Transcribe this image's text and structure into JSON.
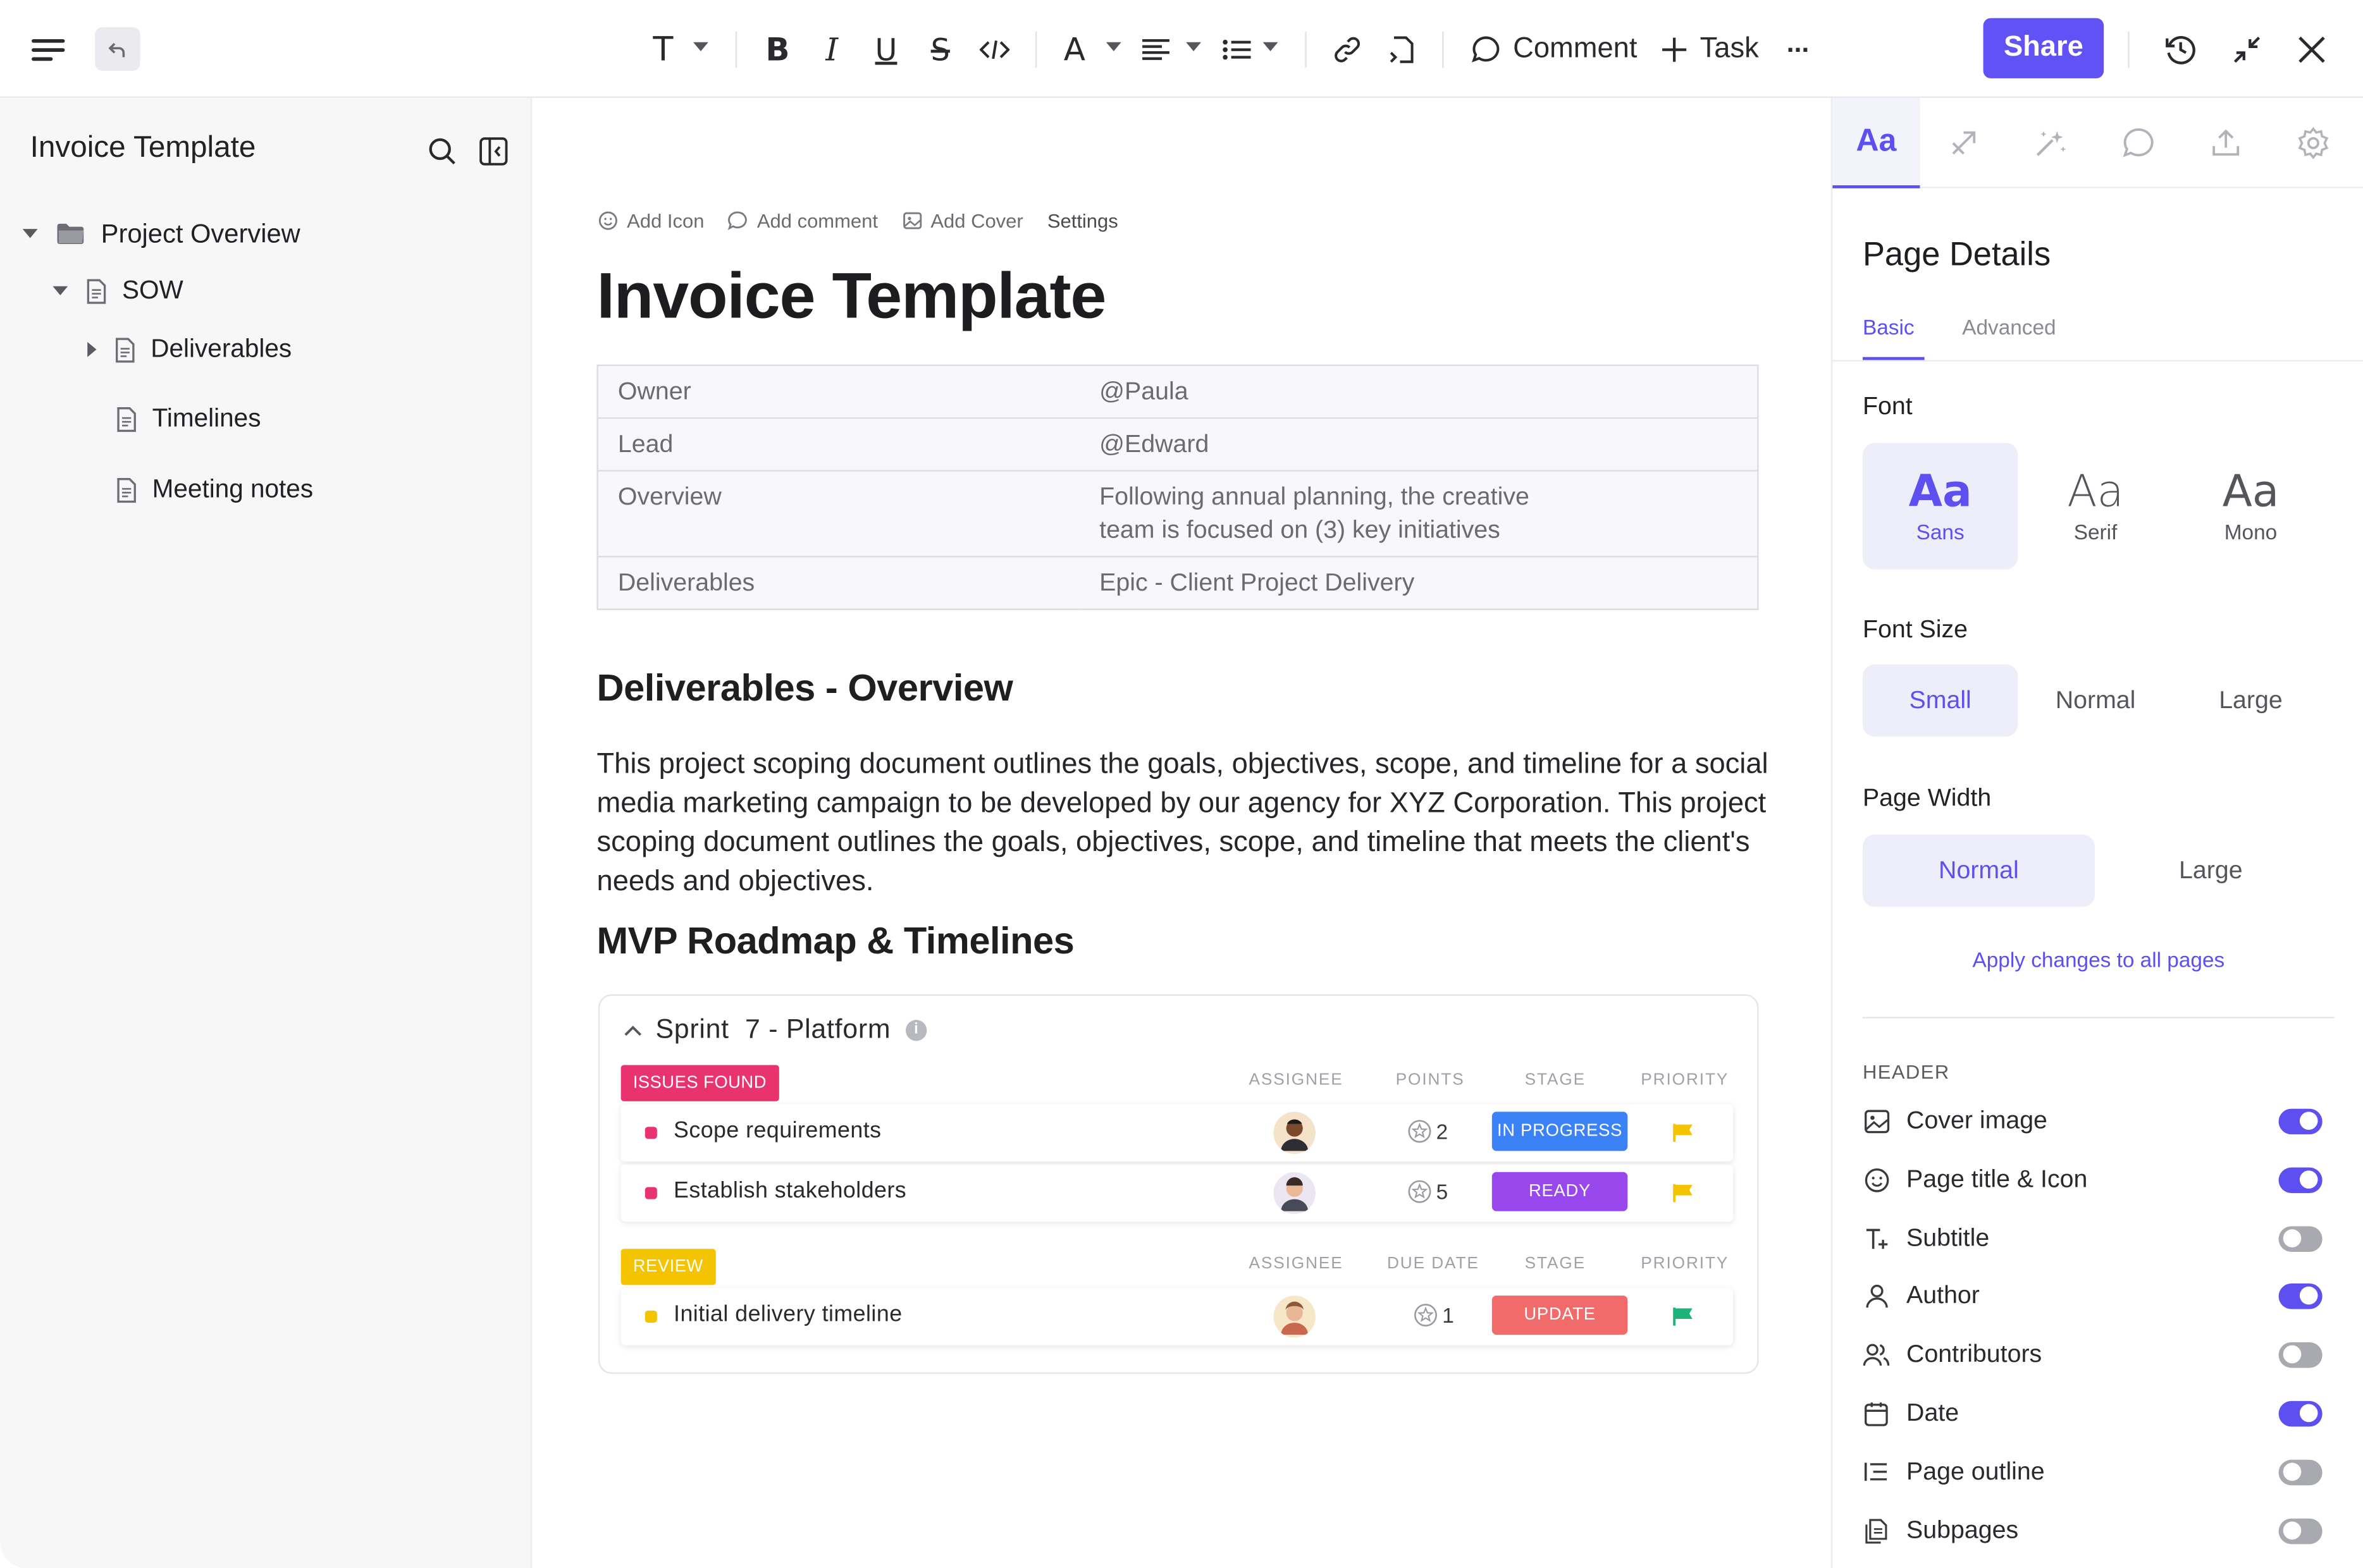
{
  "toolbar": {
    "comment_label": "Comment",
    "task_label": "Task",
    "share_label": "Share",
    "text_style_glyph": "T",
    "font_color_glyph": "A",
    "more_glyph": "···"
  },
  "sidebar": {
    "title": "Invoice Template",
    "tree": [
      {
        "label": "Project Overview",
        "icon": "folder-icon",
        "expanded": true
      },
      {
        "label": "SOW",
        "icon": "document-icon",
        "expanded": true
      },
      {
        "label": "Deliverables",
        "icon": "document-icon",
        "expanded": false
      },
      {
        "label": "Timelines",
        "icon": "document-icon"
      },
      {
        "label": "Meeting notes",
        "icon": "document-icon"
      }
    ]
  },
  "doc": {
    "actions": [
      "Add Icon",
      "Add comment",
      "Add Cover",
      "Settings"
    ],
    "title": "Invoice Template",
    "properties": [
      {
        "key": "Owner",
        "value": "@Paula"
      },
      {
        "key": "Lead",
        "value": "@Edward"
      },
      {
        "key": "Overview",
        "value": "Following annual planning, the creative",
        "value2": "team is focused on (3) key initiatives"
      },
      {
        "key": "Deliverables",
        "value": "Epic - Client Project Delivery"
      }
    ],
    "heading1": "Deliverables - Overview",
    "paragraph": "This project scoping document outlines the goals, objectives, scope, and timeline for a social media marketing campaign to be developed by our agency for XYZ Corporation. This project scoping document outlines the goals, objectives, scope, and timeline that meets the client's needs and objectives.",
    "heading2": "MVP Roadmap & Timelines"
  },
  "tasks": {
    "sprint_title": "Sprint  7 - Platform",
    "groups": [
      {
        "badge": "ISSUES FOUND",
        "badge_color": "#e8336f",
        "columns": [
          "ASSIGNEE",
          "POINTS",
          "STAGE",
          "PRIORITY"
        ],
        "rows": [
          {
            "name": "Scope requirements",
            "points": "2",
            "stage": "IN PROGRESS",
            "stage_color": "#3b82f6",
            "priority_color": "#f5c400",
            "dot_color": "#e8336f"
          },
          {
            "name": "Establish stakeholders",
            "points": "5",
            "stage": "READY",
            "stage_color": "#9747ec",
            "priority_color": "#f5c400",
            "dot_color": "#e8336f"
          }
        ]
      },
      {
        "badge": "REVIEW",
        "badge_color": "#f5c400",
        "columns": [
          "ASSIGNEE",
          "DUE DATE",
          "STAGE",
          "PRIORITY"
        ],
        "rows": [
          {
            "name": "Initial delivery timeline",
            "points": "1",
            "stage": "UPDATE",
            "stage_color": "#f26b6b",
            "priority_color": "#1bb37a",
            "dot_color": "#f5c400"
          }
        ]
      }
    ]
  },
  "panel": {
    "active_tab": "Aa",
    "title": "Page Details",
    "subtabs": [
      "Basic",
      "Advanced"
    ],
    "font_label": "Font",
    "fonts": [
      {
        "glyph": "Aa",
        "name": "Sans",
        "selected": true
      },
      {
        "glyph": "Aa",
        "name": "Serif",
        "selected": false
      },
      {
        "glyph": "Aa",
        "name": "Mono",
        "selected": false
      }
    ],
    "font_size_label": "Font Size",
    "font_sizes": [
      "Small",
      "Normal",
      "Large"
    ],
    "font_size_selected": "Small",
    "page_width_label": "Page Width",
    "page_widths": [
      "Normal",
      "Large"
    ],
    "page_width_selected": "Normal",
    "apply_label": "Apply changes to all pages",
    "header_label": "HEADER",
    "toggles": [
      {
        "label": "Cover image",
        "icon": "image-icon",
        "on": true
      },
      {
        "label": "Page title & Icon",
        "icon": "smiley-icon",
        "on": true
      },
      {
        "label": "Subtitle",
        "icon": "text-plus-icon",
        "on": false
      },
      {
        "label": "Author",
        "icon": "person-icon",
        "on": true
      },
      {
        "label": "Contributors",
        "icon": "people-icon",
        "on": false
      },
      {
        "label": "Date",
        "icon": "calendar-icon",
        "on": true
      },
      {
        "label": "Page outline",
        "icon": "outline-icon",
        "on": false
      },
      {
        "label": "Subpages",
        "icon": "pages-icon",
        "on": false
      }
    ]
  },
  "colors": {
    "accent": "#5d4ff0",
    "share": "#6152f5"
  }
}
